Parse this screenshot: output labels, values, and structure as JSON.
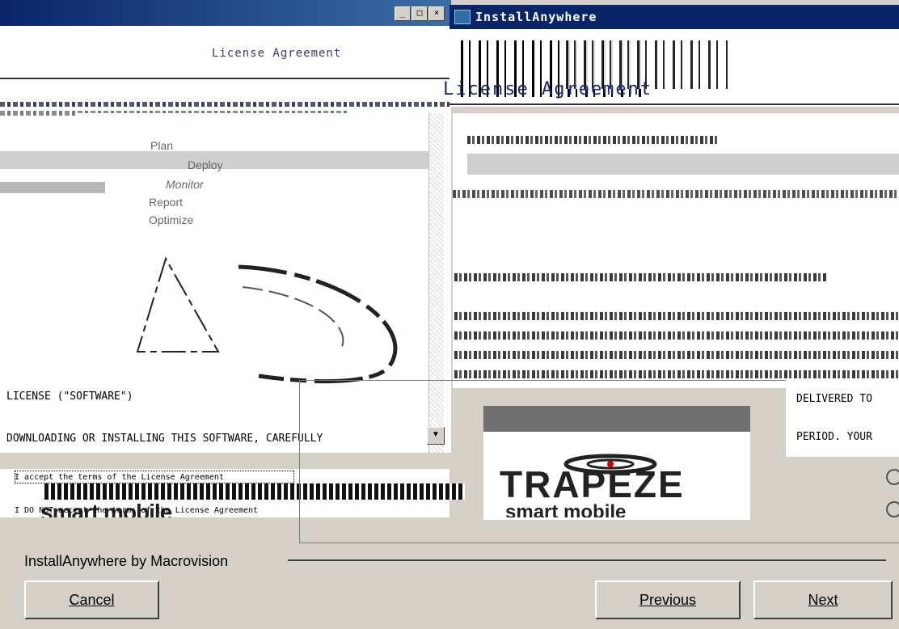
{
  "back_window": {
    "title": "License Agreement",
    "graphic_steps": [
      "Plan",
      "Deploy",
      "Monitor",
      "Report",
      "Optimize"
    ],
    "license_text": [
      "LICENSE (\"SOFTWARE\")",
      "DOWNLOADING OR INSTALLING THIS SOFTWARE, CAREFULLY"
    ],
    "radio_accept": "I accept the terms of the License Agreement",
    "radio_decline": "I DO NOT accept the terms of the License Agreement",
    "logo_text": "smart mobile"
  },
  "front_window": {
    "title": "InstallAnywhere",
    "header_title": "License Agreement",
    "right_fragments": [
      "DELIVERED TO",
      "PERIOD. YOUR"
    ],
    "logo": {
      "name": "TRAPEZE",
      "tagline": "smart mobile"
    }
  },
  "footer": {
    "brand": "InstallAnywhere by Macrovision",
    "buttons": {
      "cancel": "Cancel",
      "previous": "Previous",
      "next": "Next"
    }
  },
  "colors": {
    "titlebar": "#0a246a",
    "dialog_gray": "#d4d0c8"
  }
}
